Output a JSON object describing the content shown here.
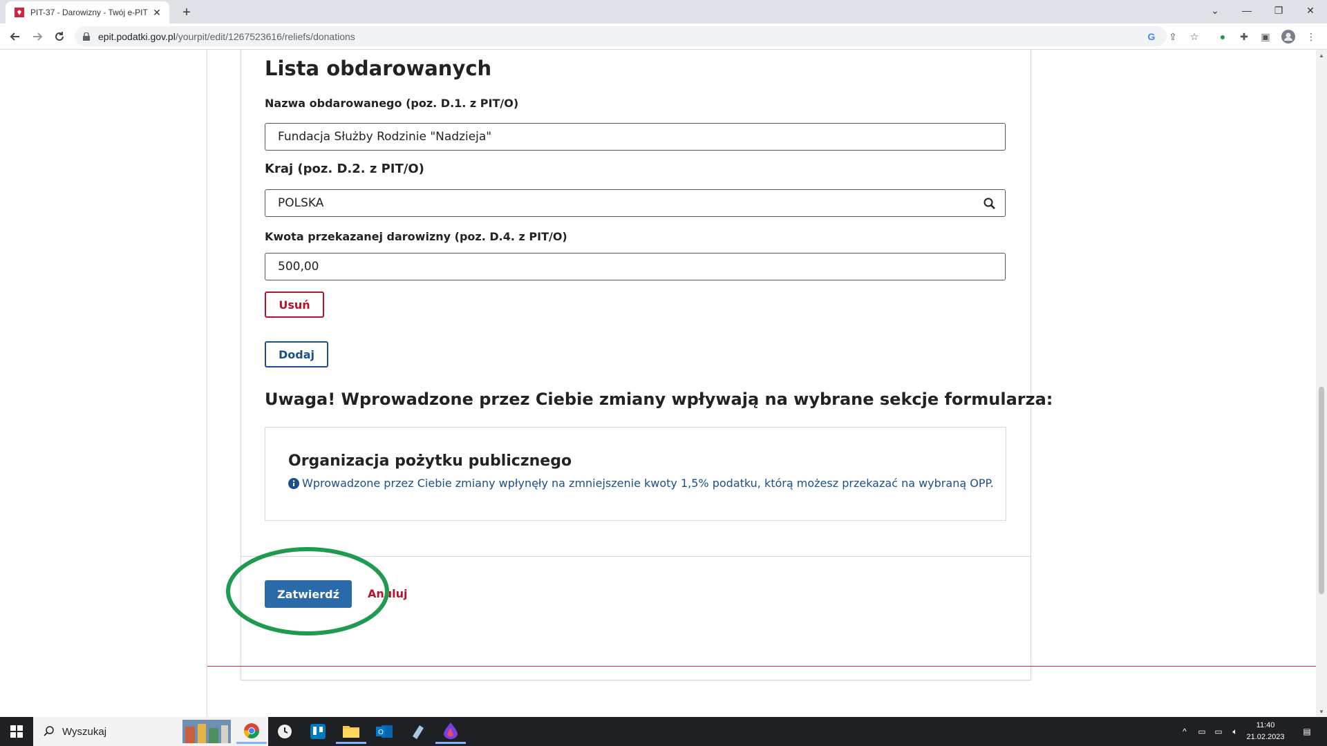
{
  "browser": {
    "tab_title": "PIT-37 - Darowizny - Twój e-PIT",
    "url_host": "epit.podatki.gov.pl",
    "url_path": "/yourpit/edit/1267523616/reliefs/donations"
  },
  "form": {
    "section_title": "Lista obdarowanych",
    "name_label": "Nazwa obdarowanego (poz. D.1. z PIT/O)",
    "name_value": "Fundacja Służby Rodzinie \"Nadzieja\"",
    "country_label": "Kraj (poz. D.2. z PIT/O)",
    "country_value": "POLSKA",
    "amount_label": "Kwota przekazanej darowizny (poz. D.4. z PIT/O)",
    "amount_value": "500,00",
    "remove_label": "Usuń",
    "add_label": "Dodaj",
    "warning_title": "Uwaga! Wprowadzone przez Ciebie zmiany wpływają na wybrane sekcje formularza:",
    "info_box_title": "Organizacja pożytku publicznego",
    "info_box_text": "Wprowadzone przez Ciebie zmiany wpłynęły na zmniejszenie kwoty 1,5% podatku, którą możesz przekazać na wybraną OPP.",
    "submit_label": "Zatwierdź",
    "cancel_label": "Anuluj"
  },
  "taskbar": {
    "search_placeholder": "Wyszukaj",
    "time": "11:40",
    "date": "21.02.2023"
  },
  "colors": {
    "primary": "#2a6aa8",
    "danger": "#b8112b",
    "link_blue": "#1b4f8a",
    "annotation_green": "#1e9b4f"
  }
}
